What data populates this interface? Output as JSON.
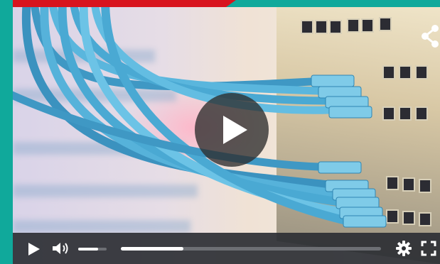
{
  "player": {
    "controls": {
      "play": "play-icon",
      "volume": "volume-icon",
      "volume_level": 0.7,
      "progress_fraction": 0.24,
      "settings": "gear-icon",
      "fullscreen": "fullscreen-icon"
    },
    "overlay": {
      "big_play": "play-circle-icon",
      "share": "share-icon"
    },
    "colors": {
      "frame_bg": "#10a99b",
      "banner": "#d8141e",
      "control_bar": "#2d2f34",
      "cables": "#4aa9d3"
    }
  }
}
